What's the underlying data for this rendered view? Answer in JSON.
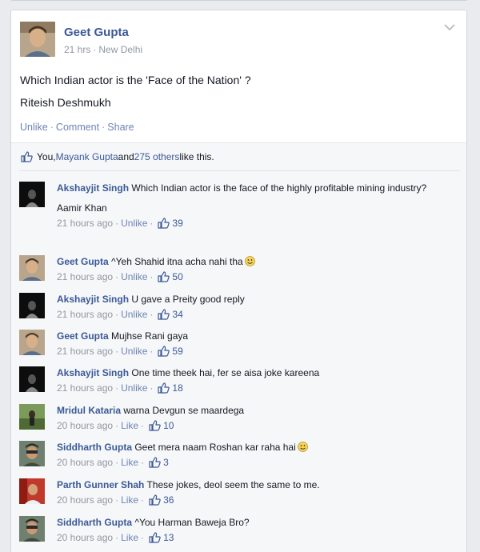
{
  "post": {
    "author": "Geet Gupta",
    "time": "21 hrs",
    "location": "New Delhi",
    "text": "Which Indian actor is the 'Face of the Nation' ?",
    "answer": "Riteish Deshmukh",
    "actions": {
      "unlike": "Unlike",
      "comment": "Comment",
      "share": "Share"
    }
  },
  "likes": {
    "prefix": "You, ",
    "friend": "Mayank Gupta",
    "middle": " and ",
    "others": "275 others",
    "suffix": " like this."
  },
  "comments": [
    {
      "name": "Akshayjit Singh",
      "text": "Which Indian actor is the face of the highly profitable mining industry?",
      "extra": "Aamir Khan",
      "time": "21 hours ago",
      "action": "Unlike",
      "likes": "39",
      "avatar": "dark"
    },
    {
      "name": "Geet Gupta",
      "text": "^Yeh Shahid itna acha nahi tha",
      "time": "21 hours ago",
      "action": "Unlike",
      "likes": "50",
      "avatar": "geet",
      "emoji": "smile-icon"
    },
    {
      "name": "Akshayjit Singh",
      "text": "U gave a Preity good reply",
      "time": "21 hours ago",
      "action": "Unlike",
      "likes": "34",
      "avatar": "dark"
    },
    {
      "name": "Geet Gupta",
      "text": "Mujhse Rani gaya",
      "time": "21 hours ago",
      "action": "Unlike",
      "likes": "59",
      "avatar": "geet"
    },
    {
      "name": "Akshayjit Singh",
      "text": "One time theek hai, fer se aisa joke kareena",
      "time": "21 hours ago",
      "action": "Unlike",
      "likes": "18",
      "avatar": "dark"
    },
    {
      "name": "Mridul Kataria",
      "text": "warna Devgun se maardega",
      "time": "20 hours ago",
      "action": "Like",
      "likes": "10",
      "avatar": "green"
    },
    {
      "name": "Siddharth Gupta",
      "text": "Geet mera naam Roshan kar raha hai",
      "time": "20 hours ago",
      "action": "Like",
      "likes": "3",
      "avatar": "sid",
      "emoji": "smile-icon"
    },
    {
      "name": "Parth Gunner Shah",
      "text": "These jokes, deol seem the same to me.",
      "time": "20 hours ago",
      "action": "Like",
      "likes": "36",
      "avatar": "red"
    },
    {
      "name": "Siddharth Gupta",
      "text": "^You Harman Baweja Bro?",
      "time": "20 hours ago",
      "action": "Like",
      "likes": "13",
      "avatar": "sid"
    }
  ],
  "colors": {
    "link": "#3b5998",
    "meta": "#9197a3",
    "action": "#6d84b4",
    "bg": "#f6f7f8"
  }
}
